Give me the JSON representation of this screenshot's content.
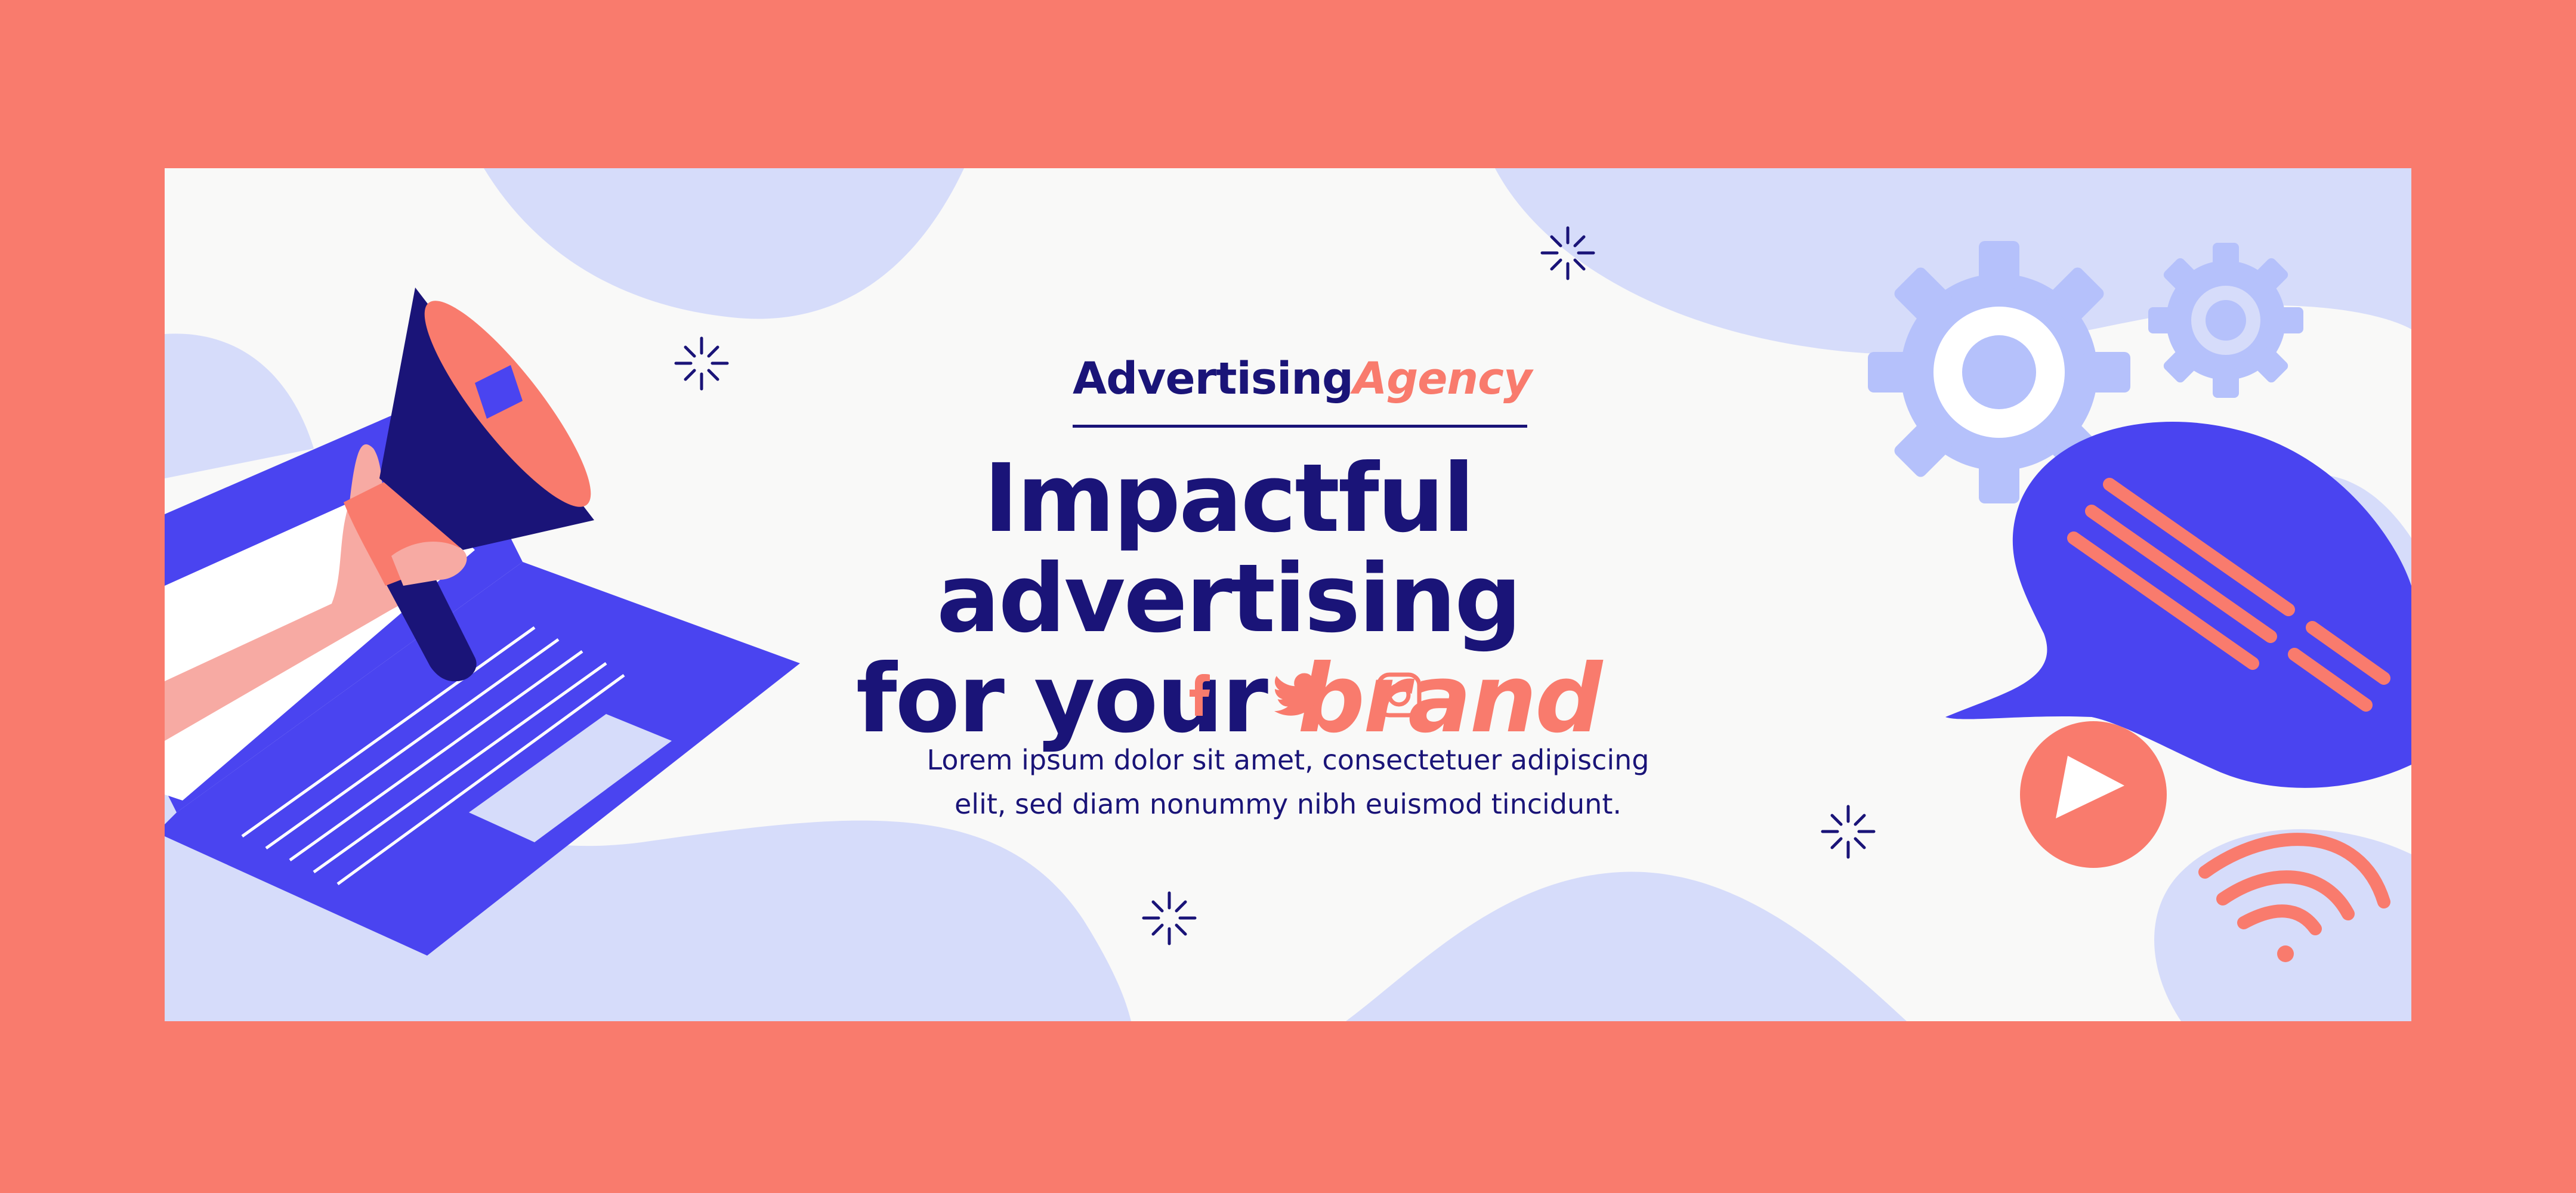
{
  "brand": {
    "name_part1": "Advertising",
    "name_part2": "Agency"
  },
  "headline": {
    "line1": "Impactful advertising",
    "line2_prefix": "for your ",
    "line2_accent": "brand"
  },
  "social": [
    {
      "icon": "facebook-icon"
    },
    {
      "icon": "twitter-icon"
    },
    {
      "icon": "instagram-icon"
    }
  ],
  "body": {
    "line1": "Lorem ipsum dolor sit amet, consectetuer adipiscing",
    "line2": "elit, sed diam nonummy nibh euismod tincidunt."
  },
  "colors": {
    "outer_background": "#f97b6d",
    "banner_background": "#f9f9f8",
    "navy": "#1a1478",
    "coral": "#f97b6d",
    "lavender": "#d6dcfa",
    "periwinkle": "#b5c1fb",
    "royal_blue": "#4a44f0"
  }
}
